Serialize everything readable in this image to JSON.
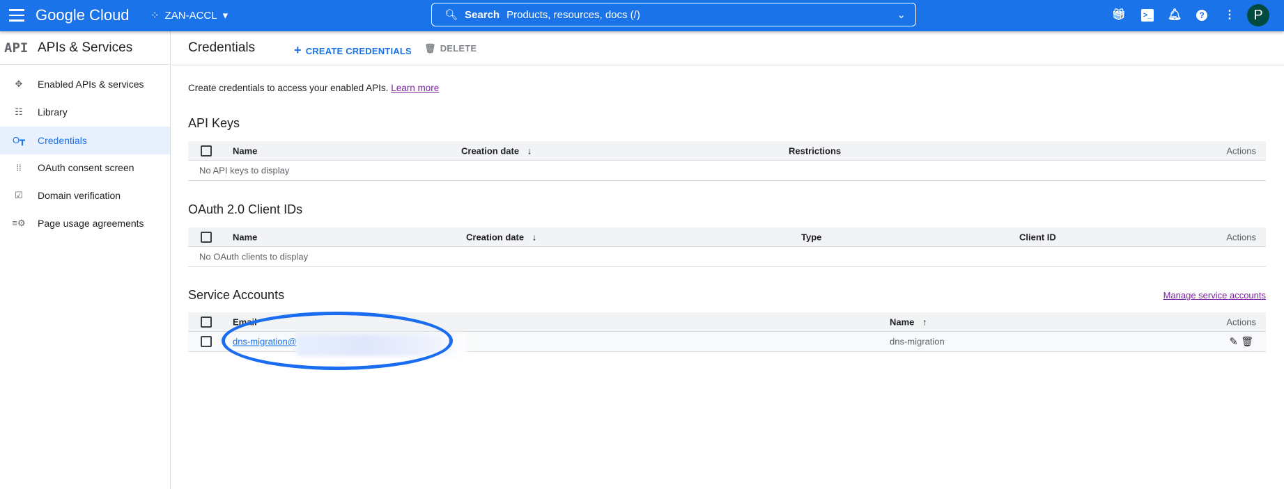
{
  "header": {
    "brand": "Google Cloud",
    "project": "ZAN-ACCL",
    "search_label": "Search",
    "search_placeholder": "Products, resources, docs (/)",
    "avatar_letter": "P",
    "color": "#1a73e8"
  },
  "sidebar": {
    "badge": "API",
    "title": "APIs & Services",
    "items": [
      {
        "label": "Enabled APIs & services",
        "icon": "move-icon"
      },
      {
        "label": "Library",
        "icon": "library-icon"
      },
      {
        "label": "Credentials",
        "icon": "key-icon",
        "selected": true
      },
      {
        "label": "OAuth consent screen",
        "icon": "consent-icon"
      },
      {
        "label": "Domain verification",
        "icon": "checkbox-icon"
      },
      {
        "label": "Page usage agreements",
        "icon": "settings-list-icon"
      }
    ]
  },
  "page": {
    "title": "Credentials",
    "create_label": "CREATE CREDENTIALS",
    "delete_label": "DELETE",
    "description": "Create credentials to access your enabled APIs.",
    "learn_more": "Learn more"
  },
  "api_keys": {
    "heading": "API Keys",
    "columns": [
      "Name",
      "Creation date",
      "Restrictions",
      "Actions"
    ],
    "empty": "No API keys to display"
  },
  "oauth": {
    "heading": "OAuth 2.0 Client IDs",
    "columns": [
      "Name",
      "Creation date",
      "Type",
      "Client ID",
      "Actions"
    ],
    "empty": "No OAuth clients to display"
  },
  "service_accounts": {
    "heading": "Service Accounts",
    "manage_link": "Manage service accounts",
    "columns": [
      "Email",
      "Name",
      "Actions"
    ],
    "rows": [
      {
        "email": "dns-migration@",
        "name": "dns-migration"
      }
    ]
  }
}
